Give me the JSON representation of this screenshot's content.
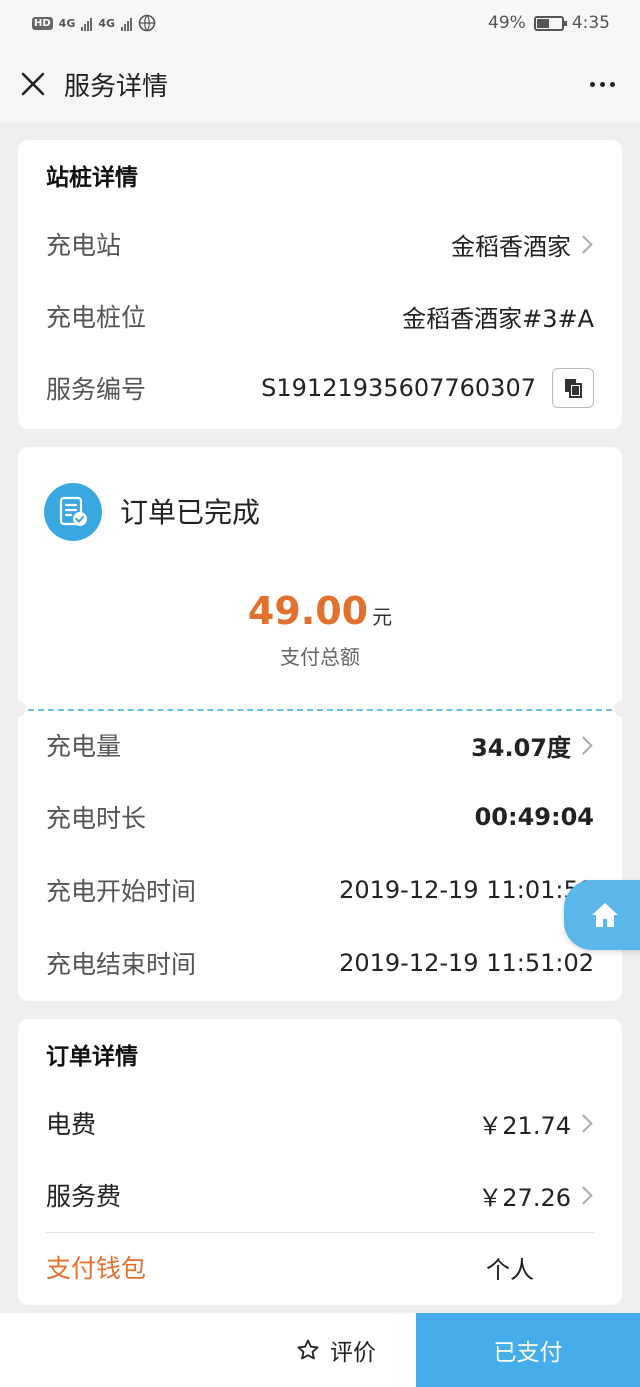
{
  "status_bar": {
    "hd": "HD",
    "net1": "4G",
    "net2": "4G",
    "battery": "49%",
    "battery_level": 0.49,
    "time": "4:35"
  },
  "nav": {
    "title": "服务详情"
  },
  "station_card": {
    "title": "站桩详情",
    "rows": [
      {
        "label": "充电站",
        "value": "金稻香酒家"
      },
      {
        "label": "充电桩位",
        "value": "金稻香酒家#3#A"
      },
      {
        "label": "服务编号",
        "value": "S19121935607760307"
      }
    ]
  },
  "order_status_card": {
    "status": "订单已完成",
    "amount": "49.00",
    "currency": "元",
    "amount_label": "支付总额",
    "rows": [
      {
        "label": "充电量",
        "value": "34.07度"
      },
      {
        "label": "充电时长",
        "value": "00:49:04"
      },
      {
        "label": "充电开始时间",
        "value": "2019-12-19 11:01:58"
      },
      {
        "label": "充电结束时间",
        "value": "2019-12-19 11:51:02"
      }
    ]
  },
  "order_detail_card": {
    "title": "订单详情",
    "rows": [
      {
        "label": "电费",
        "value": "￥21.74"
      },
      {
        "label": "服务费",
        "value": "￥27.26"
      }
    ],
    "wallet_label": "支付钱包",
    "wallet_value": "个人"
  },
  "bottom_bar": {
    "rate_label": "评价",
    "paid_label": "已支付"
  },
  "colors": {
    "accent_blue": "#45aeea",
    "amount_orange": "#e2702e"
  }
}
